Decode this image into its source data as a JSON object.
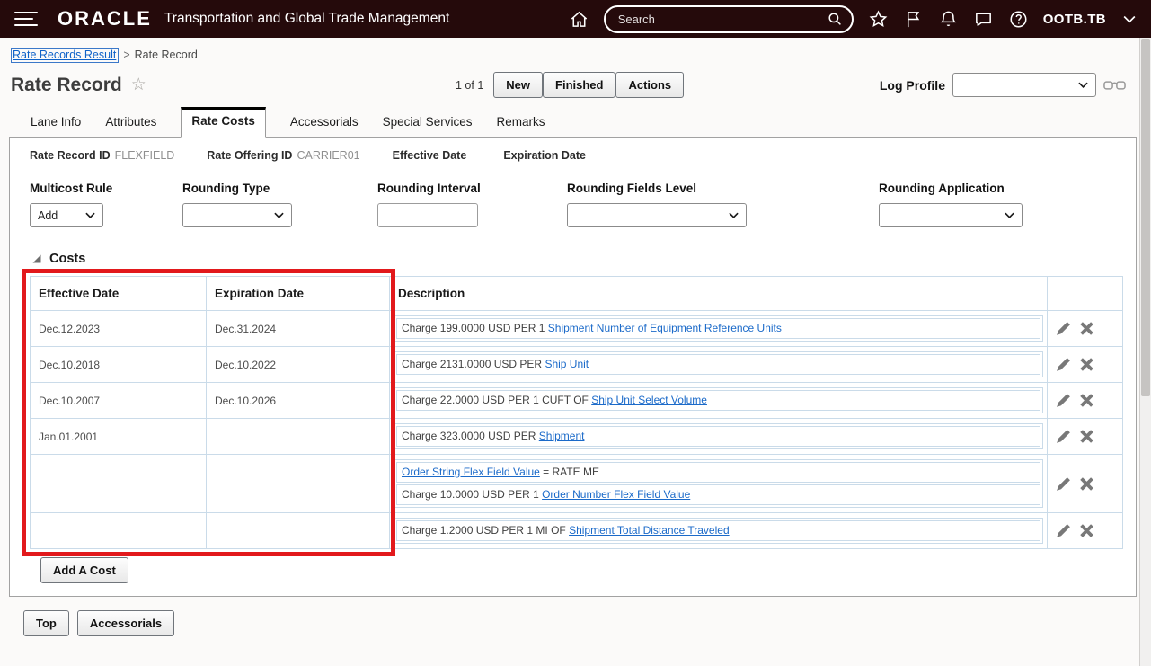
{
  "header": {
    "brand": "ORACLE",
    "app_title": "Transportation and Global Trade Management",
    "search_placeholder": "Search",
    "username": "OOTB.TB"
  },
  "breadcrumb": {
    "link": "Rate Records Result",
    "separator": ">",
    "current": "Rate Record"
  },
  "page": {
    "title": "Rate Record",
    "pagination": "1 of 1",
    "buttons": [
      "New",
      "Finished",
      "Actions"
    ],
    "log_profile_label": "Log Profile",
    "log_profile_value": ""
  },
  "tabs": [
    {
      "label": "Lane Info",
      "active": false
    },
    {
      "label": "Attributes",
      "active": false
    },
    {
      "label": "Rate Costs",
      "active": true
    },
    {
      "label": "Accessorials",
      "active": false
    },
    {
      "label": "Special Services",
      "active": false
    },
    {
      "label": "Remarks",
      "active": false
    }
  ],
  "record_info": [
    {
      "label": "Rate Record ID",
      "value": "FLEXFIELD"
    },
    {
      "label": "Rate Offering ID",
      "value": "CARRIER01"
    },
    {
      "label": "Effective Date",
      "value": ""
    },
    {
      "label": "Expiration Date",
      "value": ""
    }
  ],
  "form": {
    "multicost_rule": {
      "label": "Multicost Rule",
      "value": "Add"
    },
    "rounding_type": {
      "label": "Rounding Type",
      "value": ""
    },
    "rounding_interval": {
      "label": "Rounding Interval",
      "value": ""
    },
    "rounding_fields_level": {
      "label": "Rounding Fields Level",
      "value": ""
    },
    "rounding_application": {
      "label": "Rounding Application",
      "value": ""
    }
  },
  "costs": {
    "section_title": "Costs",
    "columns": [
      "Effective Date",
      "Expiration Date",
      "Description"
    ],
    "rows": [
      {
        "effective": "Dec.12.2023",
        "expiration": "Dec.31.2024",
        "lines": [
          {
            "prefix": "Charge 199.0000 USD PER 1 ",
            "link": "Shipment Number of Equipment Reference Units",
            "suffix": ""
          }
        ]
      },
      {
        "effective": "Dec.10.2018",
        "expiration": "Dec.10.2022",
        "lines": [
          {
            "prefix": "Charge 2131.0000 USD PER ",
            "link": "Ship Unit",
            "suffix": ""
          }
        ]
      },
      {
        "effective": "Dec.10.2007",
        "expiration": "Dec.10.2026",
        "lines": [
          {
            "prefix": "Charge 22.0000 USD PER 1 CUFT OF ",
            "link": "Ship Unit Select Volume",
            "suffix": ""
          }
        ]
      },
      {
        "effective": "Jan.01.2001",
        "expiration": "",
        "lines": [
          {
            "prefix": "Charge 323.0000 USD PER ",
            "link": "Shipment",
            "suffix": ""
          }
        ]
      },
      {
        "effective": "",
        "expiration": "",
        "lines": [
          {
            "prefix": "",
            "link": "Order String Flex Field Value",
            "suffix": " = RATE ME"
          },
          {
            "prefix": "Charge 10.0000 USD PER 1 ",
            "link": "Order Number Flex Field Value",
            "suffix": ""
          }
        ]
      },
      {
        "effective": "",
        "expiration": "",
        "lines": [
          {
            "prefix": "Charge 1.2000 USD PER 1 MI OF ",
            "link": "Shipment Total Distance Traveled",
            "suffix": ""
          }
        ]
      }
    ],
    "add_button": "Add A Cost"
  },
  "footer_buttons": [
    "Top",
    "Accessorials"
  ],
  "colors": {
    "header_background": "#250a0b",
    "link_blue": "#1b6ac9",
    "annotation_red": "#e2191c",
    "table_border": "#cadbe9"
  }
}
